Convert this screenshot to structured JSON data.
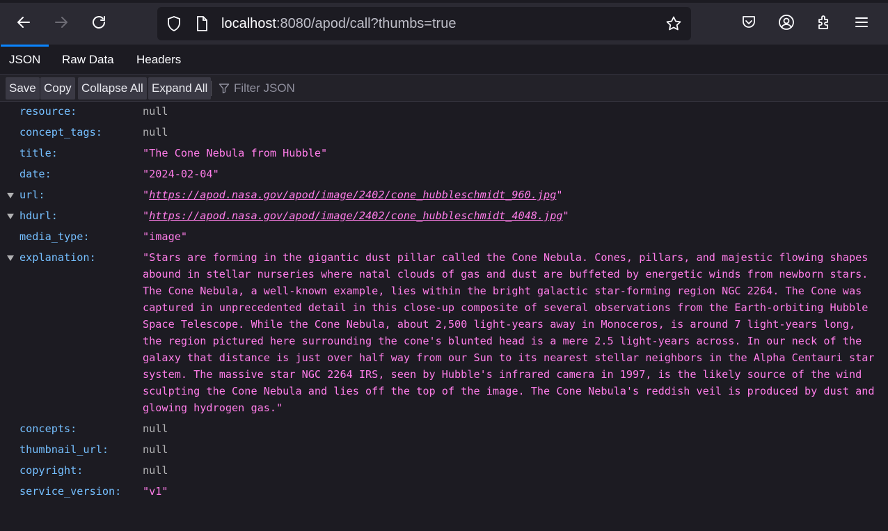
{
  "browser": {
    "url_host": "localhost",
    "url_rest": ":8080/apod/call?thumbs=true"
  },
  "tabs": [
    {
      "label": "JSON"
    },
    {
      "label": "Raw Data"
    },
    {
      "label": "Headers"
    }
  ],
  "actions": {
    "save": "Save",
    "copy": "Copy",
    "collapse_all": "Collapse All",
    "expand_all": "Expand All",
    "filter_placeholder": "Filter JSON"
  },
  "json": {
    "resource": {
      "key": "resource:",
      "value": "null"
    },
    "concept_tags": {
      "key": "concept_tags:",
      "value": "null"
    },
    "title": {
      "key": "title:",
      "value": "\"The Cone Nebula from Hubble\""
    },
    "date": {
      "key": "date:",
      "value": "\"2024-02-04\""
    },
    "url": {
      "key": "url:",
      "value": "https://apod.nasa.gov/apod/image/2402/cone_hubbleschmidt_960.jpg"
    },
    "hdurl": {
      "key": "hdurl:",
      "value": "https://apod.nasa.gov/apod/image/2402/cone_hubbleschmidt_4048.jpg"
    },
    "media_type": {
      "key": "media_type:",
      "value": "\"image\""
    },
    "explanation": {
      "key": "explanation:",
      "value": "\"Stars are forming in the gigantic dust pillar called the Cone Nebula. Cones, pillars, and majestic flowing shapes abound in stellar nurseries where natal clouds of gas and dust are buffeted by energetic winds from newborn stars. The Cone Nebula, a well-known example, lies within the bright galactic star-forming region NGC 2264. The Cone was captured in unprecedented detail in this close-up composite of several observations from the Earth-orbiting Hubble Space Telescope. While the Cone Nebula, about 2,500 light-years away in Monoceros, is around 7 light-years long, the region pictured here surrounding the cone's blunted head is a mere 2.5 light-years across. In our neck of the galaxy that distance is just over half way from our Sun to its nearest stellar neighbors in the Alpha Centauri star system. The massive star NGC 2264 IRS, seen by Hubble's infrared camera in 1997, is the likely source of the wind sculpting the Cone Nebula and lies off the top of the image. The Cone Nebula's reddish veil is produced by dust and glowing hydrogen gas.\""
    },
    "concepts": {
      "key": "concepts:",
      "value": "null"
    },
    "thumbnail_url": {
      "key": "thumbnail_url:",
      "value": "null"
    },
    "copyright": {
      "key": "copyright:",
      "value": "null"
    },
    "service_version": {
      "key": "service_version:",
      "value": "\"v1\""
    }
  }
}
